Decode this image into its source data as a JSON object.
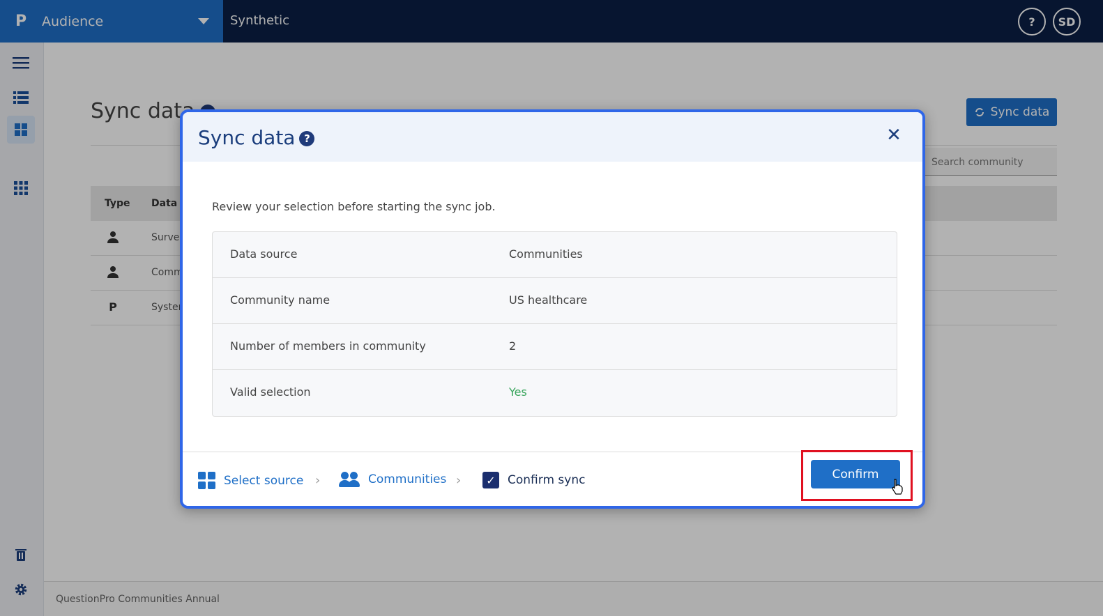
{
  "topbar": {
    "brand_logo": "P",
    "brand_name": "Audience",
    "project_name": "Synthetic",
    "help_label": "?",
    "user_initials": "SD"
  },
  "sidebar": {
    "items": [
      {
        "icon": "menu-icon"
      },
      {
        "icon": "list-icon"
      },
      {
        "icon": "dashboard-icon",
        "active": true
      },
      {
        "icon": "apps-grid-icon"
      },
      {
        "icon": "trash-icon"
      },
      {
        "icon": "gear-icon"
      }
    ]
  },
  "page": {
    "title": "Sync data",
    "sync_button_label": "Sync data",
    "search_placeholder": "Search community",
    "table": {
      "columns": [
        "Type",
        "Data s"
      ],
      "rows": [
        {
          "icon": "user-icon",
          "text": "Surve"
        },
        {
          "icon": "user-icon",
          "text": "Comm"
        },
        {
          "icon": "questionpro-logo-icon",
          "text": "Syster"
        }
      ]
    },
    "footer_text": "QuestionPro Communities Annual"
  },
  "modal": {
    "title": "Sync data",
    "help_label": "?",
    "close_label": "✕",
    "intro": "Review your selection before starting the sync job.",
    "summary": [
      {
        "label": "Data source",
        "value": "Communities"
      },
      {
        "label": "Community name",
        "value": "US healthcare"
      },
      {
        "label": "Number of members in community",
        "value": "2"
      },
      {
        "label": "Valid selection",
        "value": "Yes"
      }
    ],
    "steps": [
      {
        "label": "Select source",
        "icon": "grid-icon"
      },
      {
        "label": "Communities",
        "icon": "users-icon"
      },
      {
        "label": "Confirm sync",
        "icon": "checkbox-icon"
      }
    ],
    "confirm_label": "Confirm"
  },
  "colors": {
    "brand_blue": "#1f6fc7",
    "topbar_navy": "#0b1f45",
    "modal_border": "#2f66e8",
    "valid_green": "#3aa55d",
    "highlight_red": "#e01020"
  }
}
